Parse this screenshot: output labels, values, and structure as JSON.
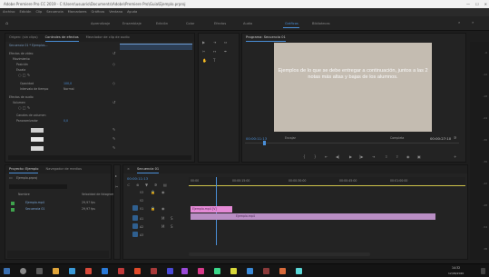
{
  "titlebar": {
    "title": "Adobe Premiere Pro CC 2019 - C:\\Users\\usuario\\Documents\\Adobe\\Premiere Pro\\Guia\\Ejemplo.prproj"
  },
  "menu": [
    "Archivo",
    "Edición",
    "Clip",
    "Secuencia",
    "Marcadores",
    "Gráficos",
    "Ventana",
    "Ayuda"
  ],
  "workspaces": [
    "Aprendizaje",
    "Ensamblaje",
    "Edición",
    "Color",
    "Efectos",
    "Audio",
    "Gráficos",
    "Bibliotecas"
  ],
  "left_panel": {
    "tabs": [
      "Origen: (sin clips)",
      "Controles de efectos",
      "Mezclador de clip de audio"
    ],
    "header": "Secuencia 01 * Ejemplos...",
    "items": [
      "Efectos de vídeo",
      "Movimiento",
      "Posición",
      "Escala",
      "Opacidad",
      "Intervalo de tiempo",
      "Efectos de audio",
      "Volumen",
      "Canales de volumen",
      "Panoramizador"
    ],
    "values": [
      "100,0",
      "0,0",
      "Normal"
    ]
  },
  "program_monitor": {
    "tab": "Programa: Secuencia 01",
    "caption": "Ejemplos de lo que se debe entregar a continuación, juntos a las 2 notas más altas y bajas de los alumnos.",
    "timecode_left": "00:00:11:13",
    "fit": "Encajar",
    "quality": "Completa",
    "timecode_right": "00:00:27:10"
  },
  "project_panel": {
    "tabs": [
      "Proyecto: Ejemplo",
      "Navegador de medios"
    ],
    "name": "Ejemplo.prproj",
    "column_name": "Nombre",
    "column_rate": "Velocidad de fotogramas",
    "items": [
      {
        "name": "Ejemplo.mp4",
        "rate": "29,97 fps"
      },
      {
        "name": "Secuencia 01",
        "rate": "29,97 fps"
      }
    ]
  },
  "timeline": {
    "tab": "Secuencia 01",
    "timecode": "00:00:11:13",
    "ruler": [
      "00:00",
      "00:00:15:00",
      "00:00:30:00",
      "00:00:45:00",
      "00:01:00:00"
    ],
    "tracks": [
      "V3",
      "V2",
      "V1",
      "A1",
      "A2",
      "A3"
    ],
    "clips": [
      "Ejemplo.mp4 [V]",
      "Ejemplo.mp4"
    ]
  },
  "meter": {
    "ticks": [
      "-6",
      "-12",
      "-18",
      "-24",
      "-30",
      "-36",
      "-42",
      "-48",
      "-54",
      "dB"
    ]
  },
  "taskbar": {
    "time": "14:32",
    "date": "12/06/2020"
  }
}
